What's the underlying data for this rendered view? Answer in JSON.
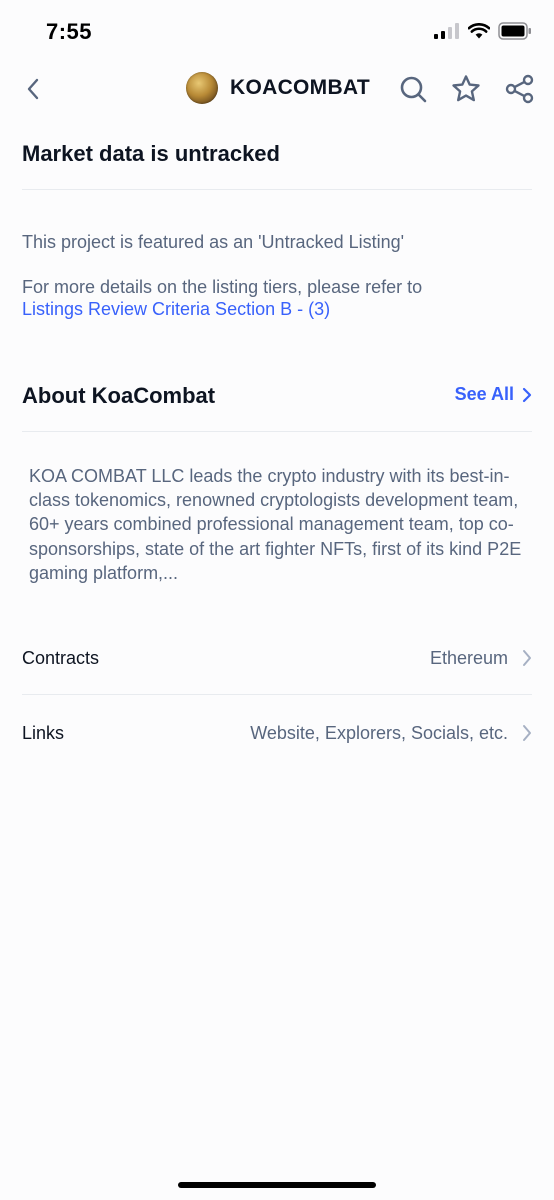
{
  "status_bar": {
    "time": "7:55"
  },
  "nav": {
    "title": "KOACOMBAT"
  },
  "market": {
    "heading": "Market data is untracked",
    "line1": "This project is featured as an 'Untracked Listing'",
    "line2": "For more details on the listing tiers, please refer to",
    "link": "Listings Review Criteria Section B - (3)"
  },
  "about": {
    "heading": "About KoaCombat",
    "see_all": "See All",
    "description": "KOA COMBAT LLC leads the crypto industry with its best-in-class tokenomics, renowned cryptologists development team, 60+ years combined professional management team, top co-sponsorships, state of the art fighter NFTs, first of its kind P2E gaming platform,..."
  },
  "contracts": {
    "label": "Contracts",
    "value": "Ethereum"
  },
  "links": {
    "label": "Links",
    "value": "Website, Explorers, Socials, etc."
  },
  "colors": {
    "accent": "#3861fb",
    "text": "#0d1421",
    "muted": "#58667e",
    "divider": "#e8ebef"
  }
}
